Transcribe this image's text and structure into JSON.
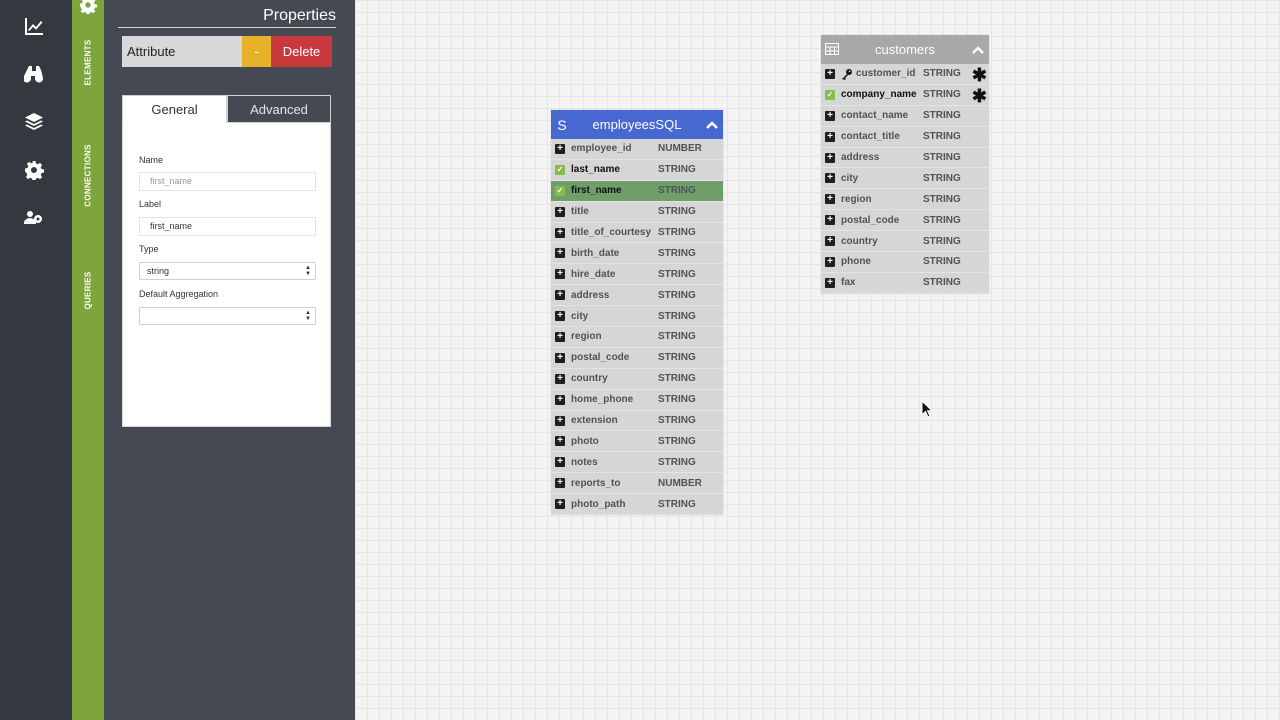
{
  "rail": {
    "icons": [
      "chart-line-icon",
      "binoculars-icon",
      "layers-icon",
      "gear-icon",
      "users-gear-icon"
    ]
  },
  "vertical_tabs": [
    "ELEMENTS",
    "CONNECTIONS",
    "QUERIES"
  ],
  "panel": {
    "title": "Properties",
    "attribute_label": "Attribute",
    "minus_label": "-",
    "delete_label": "Delete",
    "tabs": {
      "general": "General",
      "advanced": "Advanced"
    },
    "form": {
      "name_label": "Name",
      "name_placeholder": "first_name",
      "label_label": "Label",
      "label_value": "first_name",
      "type_label": "Type",
      "type_value": "string",
      "aggregation_label": "Default Aggregation",
      "aggregation_value": ""
    }
  },
  "employees": {
    "lead": "S",
    "title": "employeesSQL",
    "columns": [
      {
        "name": "employee_id",
        "type": "NUMBER",
        "state": "plus"
      },
      {
        "name": "last_name",
        "type": "STRING",
        "state": "check"
      },
      {
        "name": "first_name",
        "type": "STRING",
        "state": "active"
      },
      {
        "name": "title",
        "type": "STRING",
        "state": "plus"
      },
      {
        "name": "title_of_courtesy",
        "type": "STRING",
        "state": "plus"
      },
      {
        "name": "birth_date",
        "type": "STRING",
        "state": "plus"
      },
      {
        "name": "hire_date",
        "type": "STRING",
        "state": "plus"
      },
      {
        "name": "address",
        "type": "STRING",
        "state": "plus"
      },
      {
        "name": "city",
        "type": "STRING",
        "state": "plus"
      },
      {
        "name": "region",
        "type": "STRING",
        "state": "plus"
      },
      {
        "name": "postal_code",
        "type": "STRING",
        "state": "plus"
      },
      {
        "name": "country",
        "type": "STRING",
        "state": "plus"
      },
      {
        "name": "home_phone",
        "type": "STRING",
        "state": "plus"
      },
      {
        "name": "extension",
        "type": "STRING",
        "state": "plus"
      },
      {
        "name": "photo",
        "type": "STRING",
        "state": "plus"
      },
      {
        "name": "notes",
        "type": "STRING",
        "state": "plus"
      },
      {
        "name": "reports_to",
        "type": "NUMBER",
        "state": "plus"
      },
      {
        "name": "photo_path",
        "type": "STRING",
        "state": "plus"
      }
    ]
  },
  "customers": {
    "title": "customers",
    "columns": [
      {
        "name": "customer_id",
        "type": "STRING",
        "state": "key",
        "required": true
      },
      {
        "name": "company_name",
        "type": "STRING",
        "state": "check",
        "required": true
      },
      {
        "name": "contact_name",
        "type": "STRING",
        "state": "plus"
      },
      {
        "name": "contact_title",
        "type": "STRING",
        "state": "plus"
      },
      {
        "name": "address",
        "type": "STRING",
        "state": "plus"
      },
      {
        "name": "city",
        "type": "STRING",
        "state": "plus"
      },
      {
        "name": "region",
        "type": "STRING",
        "state": "plus"
      },
      {
        "name": "postal_code",
        "type": "STRING",
        "state": "plus"
      },
      {
        "name": "country",
        "type": "STRING",
        "state": "plus"
      },
      {
        "name": "phone",
        "type": "STRING",
        "state": "plus"
      },
      {
        "name": "fax",
        "type": "STRING",
        "state": "plus"
      }
    ]
  },
  "colors": {
    "rail": "#34383f",
    "green_strip": "#7ea53b",
    "panel": "#454a52",
    "minus_button": "#e7b12a",
    "delete_button": "#c9383d",
    "employees_header": "#4768d1",
    "customers_header": "#a8a8a8",
    "active_row": "#6f9e6a",
    "check_green": "#86bd48"
  }
}
